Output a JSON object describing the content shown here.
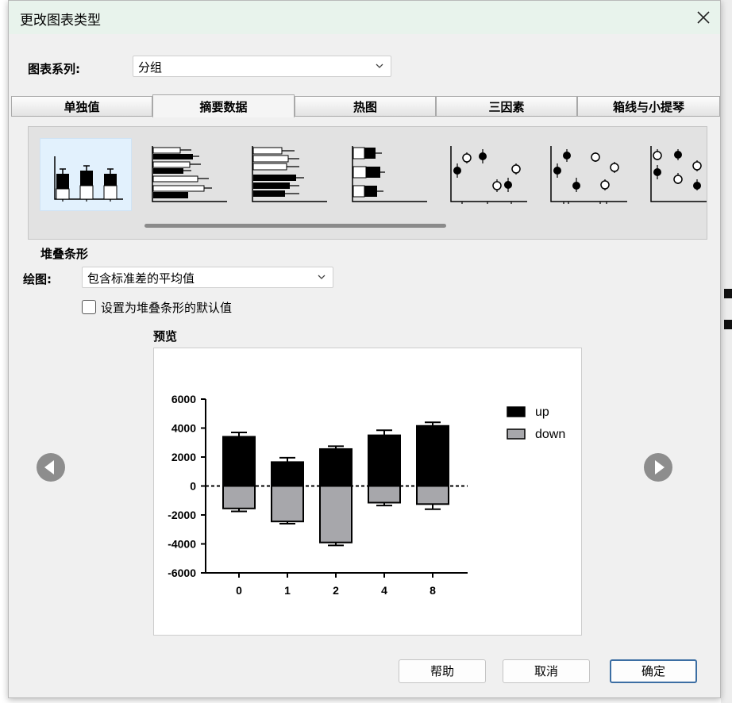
{
  "dialog": {
    "title": "更改图表类型",
    "close_icon": "close-icon"
  },
  "series": {
    "label": "图表系列:",
    "value": "分组"
  },
  "tabs": [
    {
      "label": "单独值",
      "active": false
    },
    {
      "label": "摘要数据",
      "active": true
    },
    {
      "label": "热图",
      "active": false
    },
    {
      "label": "三因素",
      "active": false
    },
    {
      "label": "箱线与小提琴",
      "active": false
    }
  ],
  "gallery": {
    "thumbnails": [
      "stacked-bar-icon",
      "horizontal-grouped-bar-icon",
      "horizontal-bar-icon",
      "horizontal-stacked-bar-icon",
      "dot-plot-icon",
      "dot-plot-alt-icon",
      "dot-plot-partial-icon"
    ],
    "selected_index": 0
  },
  "section": {
    "title": "堆叠条形"
  },
  "plot": {
    "label": "绘图:",
    "value": "包含标准差的平均值"
  },
  "default_checkbox": {
    "label": "设置为堆叠条形的默认值",
    "checked": false
  },
  "preview": {
    "label": "预览"
  },
  "chart_data": {
    "type": "bar",
    "stacked": true,
    "categories": [
      "0",
      "1",
      "2",
      "4",
      "8"
    ],
    "series": [
      {
        "name": "up",
        "values": [
          3400,
          1650,
          2550,
          3500,
          4150
        ],
        "errors": [
          300,
          300,
          200,
          350,
          250
        ],
        "color": "#000000"
      },
      {
        "name": "down",
        "values": [
          -1550,
          -2450,
          -3900,
          -1150,
          -1250
        ],
        "errors": [
          200,
          150,
          200,
          200,
          350
        ],
        "color": "#a7a7ab"
      }
    ],
    "ylim": [
      -6000,
      6000
    ],
    "yticks": [
      "6000",
      "4000",
      "2000",
      "0",
      "-2000",
      "-4000",
      "-6000"
    ],
    "legend_position": "right",
    "title": "",
    "xlabel": "",
    "ylabel": ""
  },
  "buttons": {
    "help": "帮助",
    "cancel": "取消",
    "ok": "确定"
  }
}
